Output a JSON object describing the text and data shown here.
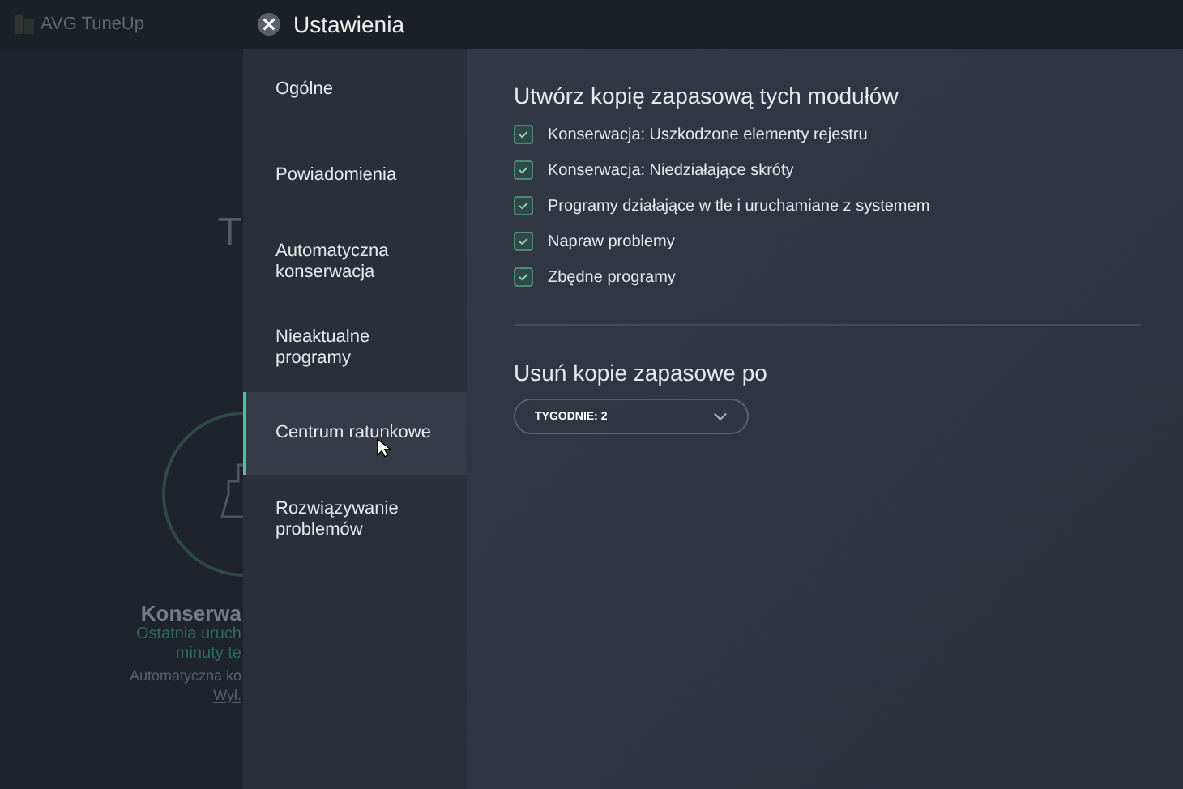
{
  "app": {
    "title": "AVG TuneUp",
    "heading": "T",
    "card": {
      "title": "Konserwa",
      "lines": [
        "Ostatnia uruch",
        "minuty te"
      ],
      "setting": "Automatyczna ko",
      "link": "Wył."
    }
  },
  "settings": {
    "title": "Ustawienia",
    "sidebar": {
      "items": [
        {
          "label": "Ogólne",
          "selected": false
        },
        {
          "label": "Powiadomienia",
          "selected": false
        },
        {
          "label": "Automatyczna konserwacja",
          "selected": false
        },
        {
          "label": "Nieaktualne programy",
          "selected": false
        },
        {
          "label": "Centrum ratunkowe",
          "selected": true
        },
        {
          "label": "Rozwiązywanie problemów",
          "selected": false
        }
      ]
    },
    "backup": {
      "heading": "Utwórz kopię zapasową tych modułów",
      "options": [
        {
          "label": "Konserwacja: Uszkodzone elementy rejestru",
          "checked": true
        },
        {
          "label": "Konserwacja: Niedziałające skróty",
          "checked": true
        },
        {
          "label": "Programy działające w tle i uruchamiane z systemem",
          "checked": true
        },
        {
          "label": "Napraw problemy",
          "checked": true
        },
        {
          "label": "Zbędne programy",
          "checked": true
        }
      ]
    },
    "delete": {
      "heading": "Usuń kopie zapasowe po",
      "dropdown": {
        "value": "TYGODNIE: 2"
      }
    }
  }
}
